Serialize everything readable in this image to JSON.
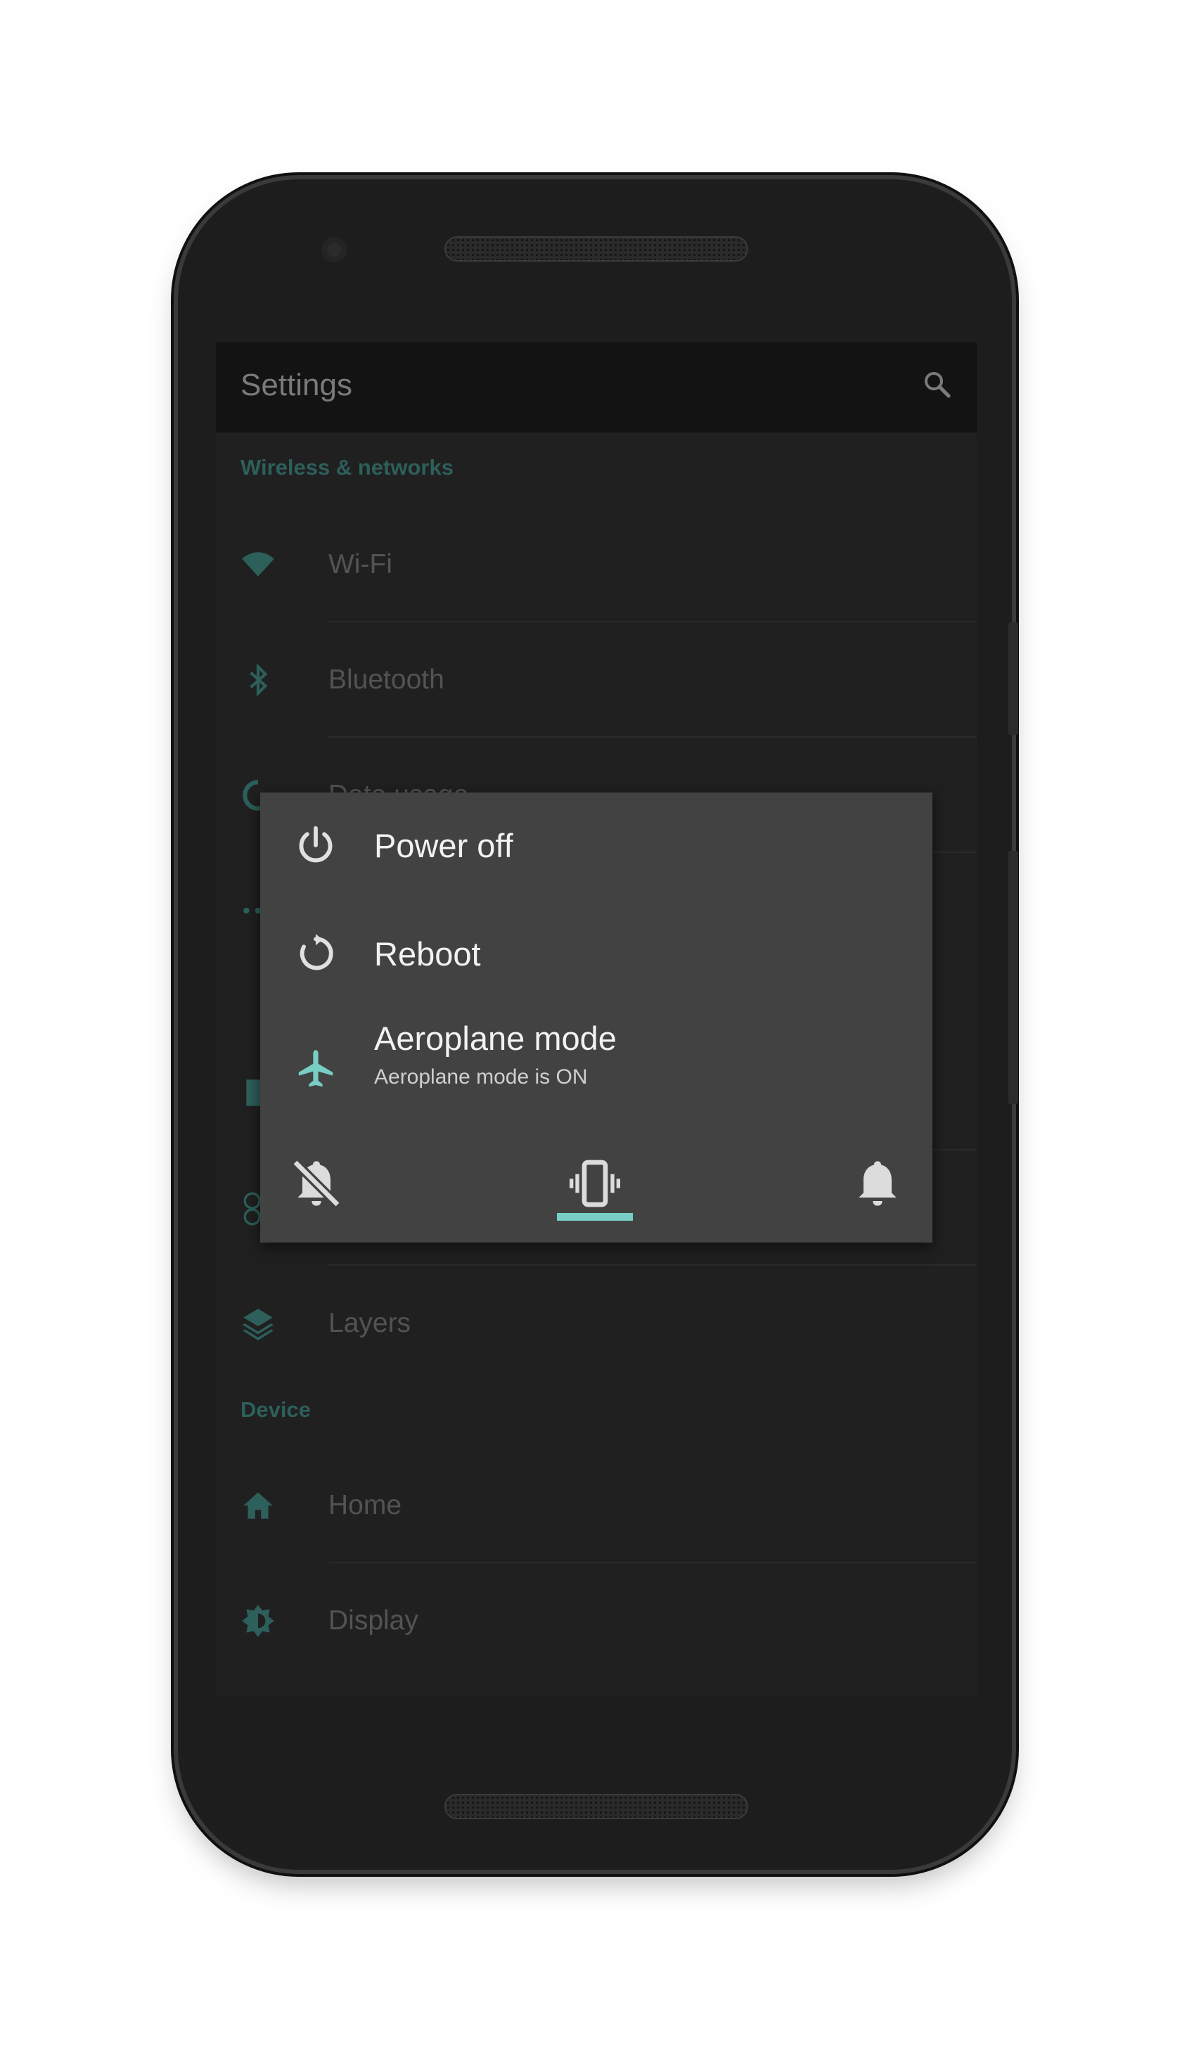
{
  "app": {
    "title": "Settings",
    "search_icon": "search-icon"
  },
  "sections": {
    "wireless": "Wireless & networks",
    "device": "Device"
  },
  "rows": [
    {
      "label": "Wi-Fi",
      "icon": "wifi-icon"
    },
    {
      "label": "Bluetooth",
      "icon": "bluetooth-icon"
    },
    {
      "label": "Data usage",
      "icon": "data-usage-icon"
    },
    {
      "label": "Layers",
      "icon": "layers-icon"
    },
    {
      "label": "Home",
      "icon": "home-icon"
    },
    {
      "label": "Display",
      "icon": "display-brightness-icon"
    }
  ],
  "power_dialog": {
    "items": [
      {
        "label": "Power off",
        "icon": "power-icon"
      },
      {
        "label": "Reboot",
        "icon": "reboot-icon"
      },
      {
        "label": "Aeroplane mode",
        "sublabel": "Aeroplane mode is ON",
        "icon": "airplane-icon"
      }
    ],
    "sound_modes": [
      {
        "name": "silent",
        "icon": "bell-off-icon",
        "selected": false
      },
      {
        "name": "vibrate",
        "icon": "vibrate-icon",
        "selected": true
      },
      {
        "name": "sound",
        "icon": "bell-icon",
        "selected": false
      }
    ]
  },
  "colors": {
    "accent": "#78cec4",
    "section_text": "#2d5f5b",
    "dialog_bg": "#424242",
    "screen_bg": "#202020"
  }
}
